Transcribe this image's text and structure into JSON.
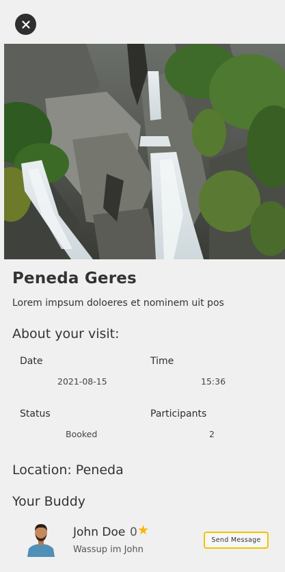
{
  "header": {
    "close_icon": "close-icon"
  },
  "hero": {
    "image_subject": "waterfall-photo"
  },
  "place": {
    "title": "Peneda Geres",
    "description": "Lorem impsum doloeres et nominem uit pos"
  },
  "visit": {
    "heading": "About your visit:",
    "date_label": "Date",
    "date_value": "2021-08-15",
    "time_label": "Time",
    "time_value": "15:36",
    "status_label": "Status",
    "status_value": "Booked",
    "participants_label": "Participants",
    "participants_value": "2"
  },
  "location": {
    "text": "Location: Peneda"
  },
  "buddy": {
    "heading": "Your Buddy",
    "name": "John Doe",
    "rating": "0",
    "rating_icon": "star-icon",
    "status": "Wassup im John",
    "send_label": "Send Message"
  },
  "colors": {
    "background": "#f0f0f0",
    "accent": "#f2c200",
    "star": "#f5b800",
    "close_button": "#2f2f2f"
  }
}
